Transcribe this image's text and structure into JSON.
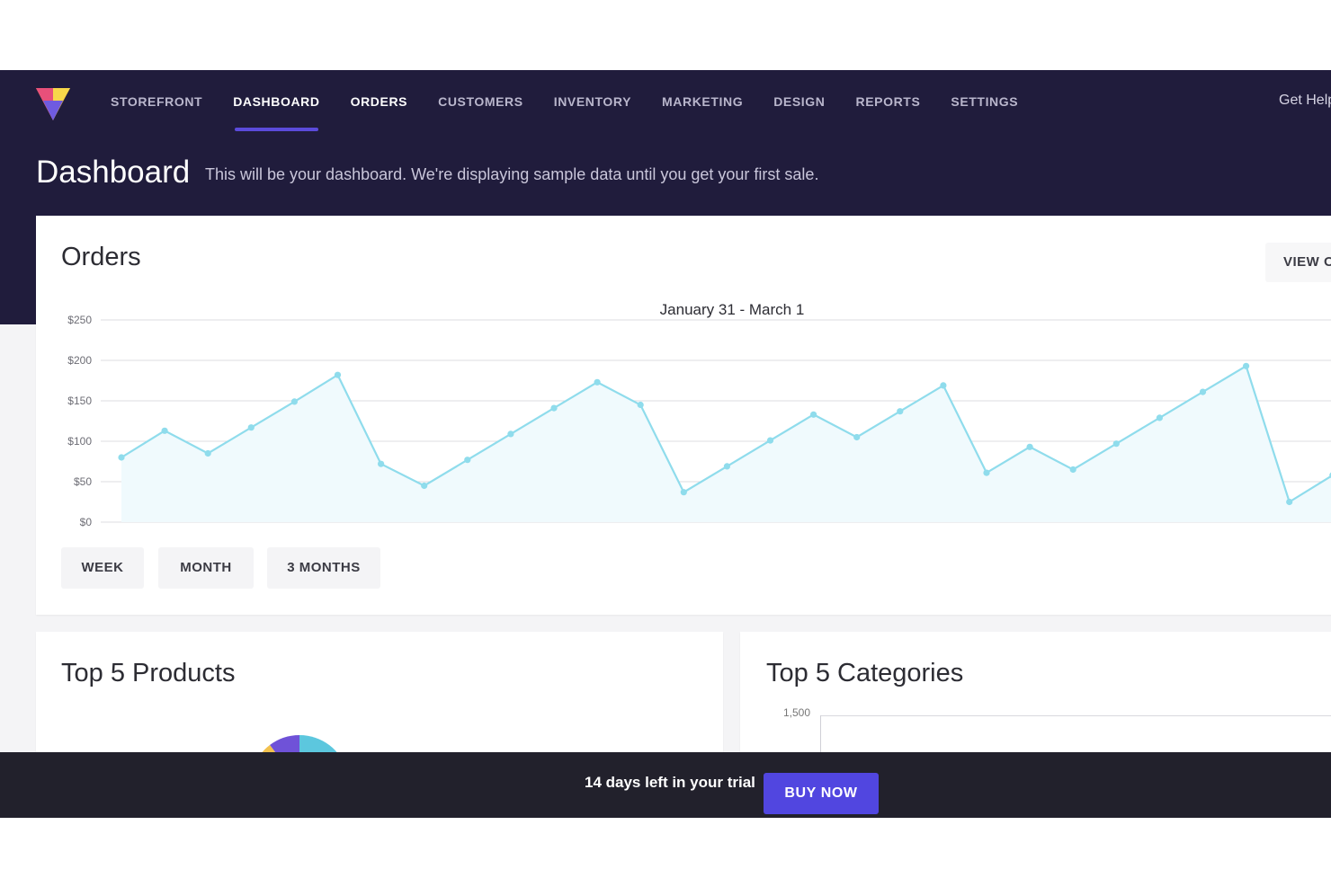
{
  "nav": {
    "items": [
      {
        "label": "STOREFRONT"
      },
      {
        "label": "DASHBOARD"
      },
      {
        "label": "ORDERS"
      },
      {
        "label": "CUSTOMERS"
      },
      {
        "label": "INVENTORY"
      },
      {
        "label": "MARKETING"
      },
      {
        "label": "DESIGN"
      },
      {
        "label": "REPORTS"
      },
      {
        "label": "SETTINGS"
      }
    ],
    "active": "DASHBOARD",
    "help_label": "Get Help"
  },
  "header": {
    "title": "Dashboard",
    "subtitle": "This will be your dashboard. We're displaying sample data until you get your first sale."
  },
  "orders": {
    "title": "Orders",
    "view_button": "VIEW ORDERS",
    "range_buttons": [
      "WEEK",
      "MONTH",
      "3 MONTHS"
    ]
  },
  "chart_data": {
    "type": "area",
    "title": "January 31 - March 1",
    "y_ticks": [
      "$0",
      "$50",
      "$100",
      "$150",
      "$200",
      "$250"
    ],
    "ylim": [
      0,
      250
    ],
    "grid": true,
    "series": [
      {
        "values": [
          80,
          113,
          85,
          117,
          149,
          182,
          72,
          45,
          77,
          109,
          141,
          173,
          145,
          37,
          69,
          101,
          133,
          105,
          137,
          169,
          61,
          93,
          65,
          97,
          129,
          161,
          193,
          25,
          58
        ]
      }
    ],
    "line_color": "#8fdcec",
    "fill_color": "#f0fafd"
  },
  "products": {
    "title": "Top 5 Products"
  },
  "categories": {
    "title": "Top 5 Categories",
    "y_tick_top": "1,500"
  },
  "trial": {
    "text": "14 days left in your trial",
    "button": "BUY NOW"
  },
  "colors": {
    "nav_bg": "#201c3c",
    "accent": "#5146e0",
    "trial_bg": "#22212c"
  }
}
